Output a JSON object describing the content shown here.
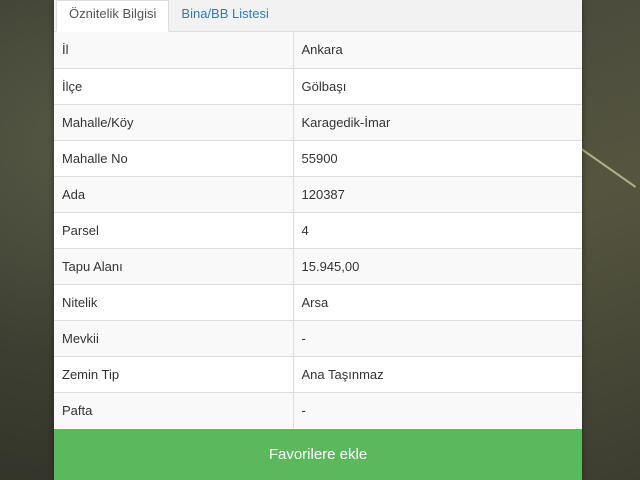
{
  "tabs": [
    {
      "label": "Öznitelik Bilgisi",
      "active": true
    },
    {
      "label": "Bina/BB Listesi",
      "active": false
    }
  ],
  "rows": [
    {
      "key": "İl",
      "value": "Ankara"
    },
    {
      "key": "İlçe",
      "value": "Gölbaşı"
    },
    {
      "key": "Mahalle/Köy",
      "value": "Karagedik-İmar"
    },
    {
      "key": "Mahalle No",
      "value": "55900"
    },
    {
      "key": "Ada",
      "value": "120387"
    },
    {
      "key": "Parsel",
      "value": "4"
    },
    {
      "key": "Tapu Alanı",
      "value": "15.945,00"
    },
    {
      "key": "Nitelik",
      "value": "Arsa"
    },
    {
      "key": "Mevkii",
      "value": "-"
    },
    {
      "key": "Zemin Tip",
      "value": "Ana Taşınmaz"
    },
    {
      "key": "Pafta",
      "value": "-"
    }
  ],
  "favorite_button": {
    "label": "Favorilere ekle"
  },
  "colors": {
    "button": "#5cb85c",
    "link": "#337ab7",
    "stripe": "#f9f9f9"
  }
}
